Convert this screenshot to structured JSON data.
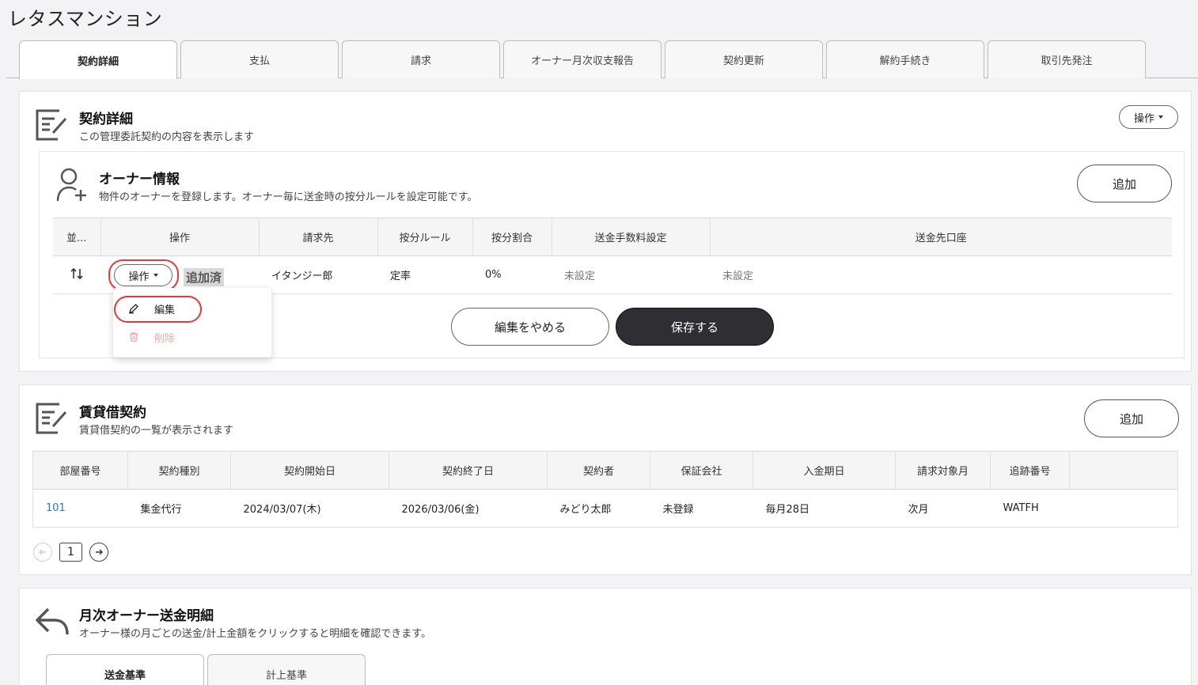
{
  "page": {
    "title": "レタスマンション"
  },
  "tabs": [
    {
      "label": "契約詳細",
      "active": true
    },
    {
      "label": "支払"
    },
    {
      "label": "請求"
    },
    {
      "label": "オーナー月次収支報告"
    },
    {
      "label": "契約更新"
    },
    {
      "label": "解約手続き"
    },
    {
      "label": "取引先発注"
    }
  ],
  "contract": {
    "title": "契約詳細",
    "subtitle": "この管理委託契約の内容を表示します",
    "action_label": "操作"
  },
  "owner": {
    "title": "オーナー情報",
    "subtitle": "物件のオーナーを登録します。オーナー毎に送金時の按分ルールを設定可能です。",
    "add_label": "追加",
    "columns": [
      "並...",
      "操作",
      "請求先",
      "按分ルール",
      "按分割合",
      "送金手数料設定",
      "送金先口座"
    ],
    "row": {
      "sort_icon": "sort-arrows-icon",
      "action_label": "操作",
      "added_badge": "追加済",
      "billing": "イタンジー郎",
      "rule": "定率",
      "ratio": "0%",
      "fee": "未設定",
      "account": "未設定"
    },
    "menu": {
      "edit": "編集",
      "delete": "削除",
      "edit_icon": "pencil-icon",
      "delete_icon": "trash-icon"
    },
    "cancel_label": "編集をやめる",
    "save_label": "保存する"
  },
  "lease": {
    "title": "賃貸借契約",
    "subtitle": "賃貸借契約の一覧が表示されます",
    "add_label": "追加",
    "columns": [
      "部屋番号",
      "契約種別",
      "契約開始日",
      "契約終了日",
      "契約者",
      "保証会社",
      "入金期日",
      "請求対象月",
      "追跡番号",
      ""
    ],
    "rows": [
      [
        "101",
        "集金代行",
        "2024/03/07(木)",
        "2026/03/06(金)",
        "みどり太郎",
        "未登録",
        "毎月28日",
        "次月",
        "WATFH",
        ""
      ]
    ],
    "page": "1"
  },
  "remit": {
    "title": "月次オーナー送金明細",
    "subtitle": "オーナー様の月ごとの送金/計上金額をクリックすると明細を確認できます。",
    "tabs": [
      {
        "label": "送金基準",
        "active": true
      },
      {
        "label": "計上基準"
      }
    ]
  },
  "colors": {
    "accent_red": "#e53935",
    "dark_button": "#2f2e33",
    "link": "#2f78c4",
    "delete_pink": "#f2a7a7"
  }
}
